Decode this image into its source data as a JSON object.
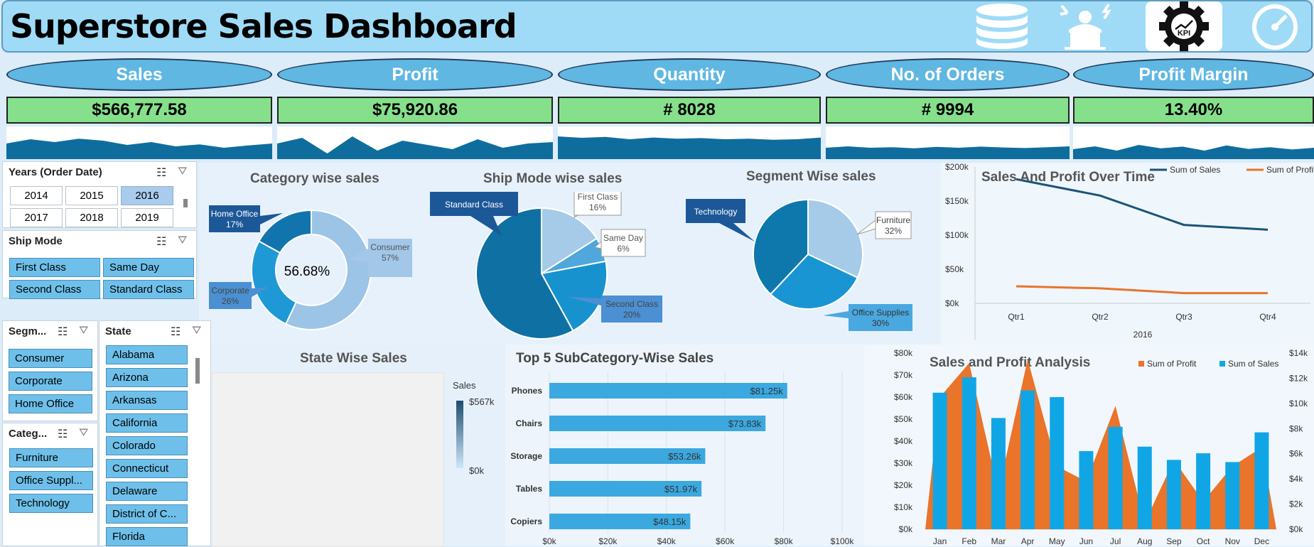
{
  "header": {
    "title": "Superstore Sales Dashboard",
    "kpi_icon_text": "KPI"
  },
  "kpis": [
    {
      "label": "Sales",
      "value": "$566,777.58"
    },
    {
      "label": "Profit",
      "value": "$75,920.86"
    },
    {
      "label": "Quantity",
      "value": "# 8028"
    },
    {
      "label": "No. of Orders",
      "value": "# 9994"
    },
    {
      "label": "Profit Margin",
      "value": "13.40%"
    }
  ],
  "slicers": {
    "years": {
      "title": "Years (Order Date)",
      "items": [
        "2014",
        "2015",
        "2016",
        "2017",
        "2018",
        "2019"
      ],
      "selected": "2016"
    },
    "ship_mode": {
      "title": "Ship Mode",
      "items": [
        "First Class",
        "Same Day",
        "Second Class",
        "Standard Class"
      ]
    },
    "segment": {
      "title": "Segm...",
      "items": [
        "Consumer",
        "Corporate",
        "Home Office"
      ]
    },
    "category": {
      "title": "Categ...",
      "items": [
        "Furniture",
        "Office Suppl...",
        "Technology"
      ]
    },
    "state": {
      "title": "State",
      "items": [
        "Alabama",
        "Arizona",
        "Arkansas",
        "California",
        "Colorado",
        "Connecticut",
        "Delaware",
        "District of C...",
        "Florida"
      ]
    }
  },
  "chart_data": [
    {
      "type": "pie",
      "variant": "donut",
      "title": "Category wise sales",
      "center_label": "56.68%",
      "slices": [
        {
          "label": "Consumer",
          "pct": "57%",
          "value": 57
        },
        {
          "label": "Corporate",
          "pct": "26%",
          "value": 26
        },
        {
          "label": "Home Office",
          "pct": "17%",
          "value": 17
        }
      ],
      "colors": [
        "#9cc4e6",
        "#1f98d6",
        "#1274ad"
      ]
    },
    {
      "type": "pie",
      "title": "Ship Mode wise sales",
      "slices": [
        {
          "label": "First Class",
          "pct": "16%",
          "value": 16
        },
        {
          "label": "Same Day",
          "pct": "6%",
          "value": 6
        },
        {
          "label": "Second Class",
          "pct": "20%",
          "value": 20
        },
        {
          "label": "Standard Class",
          "pct": "58%",
          "value": 58
        }
      ],
      "colors": [
        "#a6cbe9",
        "#4fa7dc",
        "#1892cf",
        "#0e70a3"
      ]
    },
    {
      "type": "pie",
      "title": "Segment Wise sales",
      "slices": [
        {
          "label": "Furniture",
          "pct": "32%",
          "value": 32
        },
        {
          "label": "Office Supplies",
          "pct": "30%",
          "value": 30
        },
        {
          "label": "Technology",
          "pct": "38%",
          "value": 38
        }
      ],
      "colors": [
        "#a6cbe9",
        "#1895d2",
        "#0e78ad"
      ]
    },
    {
      "type": "line",
      "title": "Sales And Profit Over Time",
      "categories": [
        "Qtr1",
        "Qtr2",
        "Qtr3",
        "Qtr4"
      ],
      "xgroup": "2016",
      "ylim": [
        0,
        200000
      ],
      "yticks": [
        "$0k",
        "$50k",
        "$100k",
        "$150k",
        "$200k"
      ],
      "series": [
        {
          "name": "Sum of Sales",
          "values": [
            182000,
            158000,
            115000,
            108000
          ],
          "color": "#1b5478"
        },
        {
          "name": "Sum of Profit",
          "values": [
            25000,
            22000,
            15000,
            15000
          ],
          "color": "#e9742a"
        }
      ]
    },
    {
      "type": "map",
      "title": "State Wise Sales",
      "legend_title": "Sales",
      "legend_max": "$567k",
      "legend_min": "$0k"
    },
    {
      "type": "bar",
      "orientation": "horizontal",
      "title": "Top 5 SubCategory-Wise Sales",
      "categories": [
        "Phones",
        "Chairs",
        "Storage",
        "Tables",
        "Copiers"
      ],
      "values": [
        81250,
        73830,
        53260,
        51970,
        48150
      ],
      "labels": [
        "$81.25k",
        "$73.83k",
        "$53.26k",
        "$51.97k",
        "$48.15k"
      ],
      "xlim": [
        0,
        100000
      ],
      "xticks": [
        "$0k",
        "$20k",
        "$40k",
        "$60k",
        "$80k",
        "$100k"
      ],
      "color": "#3ba8e0"
    },
    {
      "type": "bar",
      "title": "Sales and Profit Analysis",
      "categories": [
        "Jan",
        "Feb",
        "Mar",
        "Apr",
        "May",
        "Jun",
        "Jul",
        "Aug",
        "Sep",
        "Oct",
        "Nov",
        "Dec"
      ],
      "series": [
        {
          "name": "Sum of Profit",
          "type": "area",
          "axis": "right",
          "values": [
            10500,
            13200,
            3000,
            13500,
            5000,
            3800,
            9800,
            500,
            5500,
            2200,
            5000,
            6500
          ],
          "color": "#e9742a"
        },
        {
          "name": "Sum of Sales",
          "type": "bar",
          "axis": "left",
          "values": [
            62000,
            69000,
            50500,
            63000,
            60000,
            35500,
            46500,
            37500,
            31500,
            34500,
            30500,
            44000
          ],
          "color": "#10a6e6"
        }
      ],
      "ylim": [
        0,
        80000
      ],
      "yticks": [
        "$0k",
        "$10k",
        "$20k",
        "$30k",
        "$40k",
        "$50k",
        "$60k",
        "$70k",
        "$80k"
      ],
      "y2lim": [
        0,
        14000
      ],
      "y2ticks": [
        "$0k",
        "$2k",
        "$4k",
        "$6k",
        "$8k",
        "$10k",
        "$12k",
        "$14k"
      ]
    }
  ],
  "sparklines": [
    [
      0.55,
      0.7,
      0.6,
      0.72,
      0.65,
      0.5,
      0.6,
      0.45,
      0.52,
      0.4,
      0.48,
      0.55
    ],
    [
      0.55,
      0.75,
      0.2,
      0.8,
      0.3,
      0.65,
      0.5,
      0.35,
      0.7,
      0.4,
      0.55,
      0.6
    ],
    [
      0.8,
      0.75,
      0.78,
      0.7,
      0.76,
      0.72,
      0.74,
      0.7,
      0.72,
      0.68,
      0.7,
      0.76
    ],
    [
      0.4,
      0.45,
      0.4,
      0.42,
      0.38,
      0.43,
      0.4,
      0.44,
      0.41,
      0.39,
      0.42,
      0.45
    ],
    [
      0.35,
      0.45,
      0.3,
      0.5,
      0.38,
      0.44,
      0.3,
      0.48,
      0.36,
      0.42,
      0.34,
      0.4
    ]
  ]
}
